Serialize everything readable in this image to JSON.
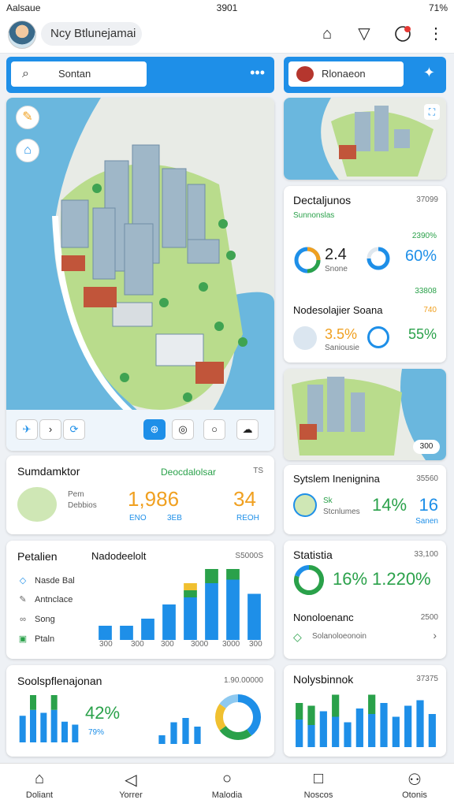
{
  "status_bar": {
    "left": "Aalsaue",
    "center": "3901",
    "right": "71%"
  },
  "app_bar": {
    "title": "Ncy Btlunejamai",
    "icons": [
      "home-icon",
      "filter-icon",
      "chat-icon",
      "more-icon"
    ]
  },
  "search": {
    "placeholder": "Sontan",
    "value": "Sontan"
  },
  "side_header": {
    "label": "Rlonaeon"
  },
  "map_controls": {
    "left": [
      "navigate-icon",
      "chevron-right-icon",
      "refresh-icon"
    ],
    "right": [
      "locate-icon",
      "layers-icon",
      "circle-icon",
      "cloud-icon"
    ]
  },
  "card_sector": {
    "title": "Dectaljunos",
    "meta": "37099",
    "sub": "Sunnonslas",
    "pct_top": "2390%",
    "v1": "2.4",
    "v1_sub": "Snone",
    "v2": "60%",
    "small_pct": "33808",
    "title2": "Nodesolajier Soana",
    "meta2": "740",
    "v3": "3.5%",
    "v3_sub": "Saniousie",
    "v4": "55%"
  },
  "mini_map": {
    "badge": "300"
  },
  "sumdamktor": {
    "title": "Sumdamktor",
    "link": "Deocdalolsar",
    "meta": "TS",
    "l1": "Pem",
    "l2": "Debbios",
    "big1": "1,986",
    "big1_sub1": "ENO",
    "big1_sub2": "3EB",
    "big2": "34",
    "big2_sub": "REOH"
  },
  "system": {
    "title": "Sytslem Inenignina",
    "meta": "35560",
    "l1": "Sk",
    "l2": "Stcnlumes",
    "v1": "14%",
    "v2": "16",
    "v2_sub": "Sanen"
  },
  "petalien": {
    "title": "Petalien",
    "chart_title": "Nadodeelolt",
    "meta": "S5000S",
    "items": [
      "Nasde Bal",
      "Antnclace",
      "Song",
      "Ptaln"
    ],
    "xticks": [
      "300",
      "300",
      "300",
      "3000",
      "3000",
      "300"
    ]
  },
  "statistia": {
    "title": "Statistia",
    "meta": "33,100",
    "v1": "16%",
    "v2": "1.220%",
    "l": "Nonoloenanc",
    "l_meta": "2500",
    "l_sub": "Solanoloeonoin"
  },
  "bottom_left": {
    "title": "Soolspflenajonan",
    "meta": "1.90.00000",
    "big": "42%",
    "sub": "79%"
  },
  "bottom_right": {
    "title": "Nolysbinnok",
    "meta": "37375"
  },
  "chart_data": [
    {
      "type": "bar",
      "title": "Nadodeelolt",
      "series": [
        {
          "name": "blue",
          "values": [
            20,
            20,
            30,
            50,
            60,
            80,
            85,
            65
          ]
        },
        {
          "name": "green",
          "values": [
            0,
            0,
            0,
            0,
            10,
            40,
            55,
            0
          ]
        },
        {
          "name": "yellow",
          "values": [
            0,
            0,
            0,
            0,
            10,
            5,
            5,
            0
          ]
        }
      ],
      "ylim": [
        0,
        100
      ]
    },
    {
      "type": "bar",
      "title": "Soolspflenajonan",
      "series": [
        {
          "name": "blue",
          "values": [
            45,
            55,
            50,
            55,
            35,
            30
          ]
        },
        {
          "name": "green",
          "values": [
            0,
            35,
            0,
            30,
            0,
            0
          ]
        }
      ],
      "ylim": [
        0,
        80
      ]
    },
    {
      "type": "bar",
      "title": "Nolysbinnok",
      "series": [
        {
          "name": "blue",
          "values": [
            50,
            40,
            65,
            55,
            45,
            70,
            60,
            80,
            55,
            75,
            85,
            60
          ]
        },
        {
          "name": "green",
          "values": [
            30,
            35,
            0,
            40,
            0,
            0,
            35,
            0,
            0,
            0,
            0,
            0
          ]
        }
      ],
      "ylim": [
        0,
        100
      ]
    },
    {
      "type": "pie",
      "title": "Statistia",
      "values": [
        80,
        20
      ]
    },
    {
      "type": "pie",
      "title": "Soolspflenajonan",
      "values": [
        40,
        25,
        20,
        15
      ]
    }
  ],
  "nav": [
    {
      "label": "Doliant",
      "icon": "home-icon"
    },
    {
      "label": "Yorrer",
      "icon": "map-icon"
    },
    {
      "label": "Malodia",
      "icon": "circle-icon"
    },
    {
      "label": "Noscos",
      "icon": "square-icon"
    },
    {
      "label": "Otonis",
      "icon": "profile-icon"
    }
  ],
  "colors": {
    "blue": "#1e8fe8",
    "green": "#2aa14a",
    "orange": "#f0a020"
  }
}
